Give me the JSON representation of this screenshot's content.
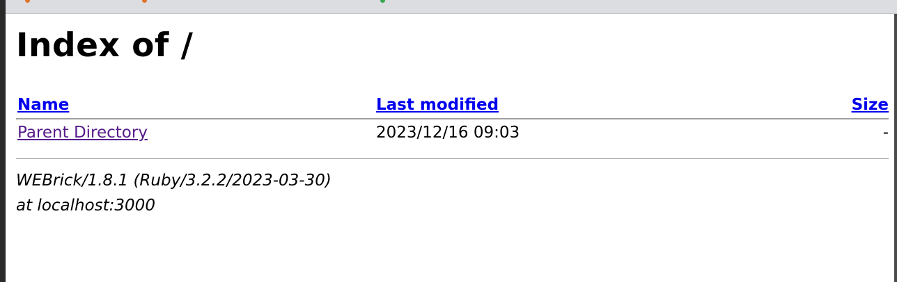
{
  "page": {
    "heading": "Index of /"
  },
  "listing": {
    "columns": {
      "name": "Name",
      "last_modified": "Last modified",
      "size": "Size"
    },
    "rows": [
      {
        "name": "Parent Directory",
        "last_modified": "2023/12/16 09:03",
        "size": "-"
      }
    ]
  },
  "footer": {
    "server": "WEBrick/1.8.1 (Ruby/3.2.2/2023-03-30)",
    "host": "at localhost:3000"
  },
  "colors": {
    "link": "#0000ee",
    "visited_link": "#551a8b",
    "rule": "#a0a0a0"
  }
}
